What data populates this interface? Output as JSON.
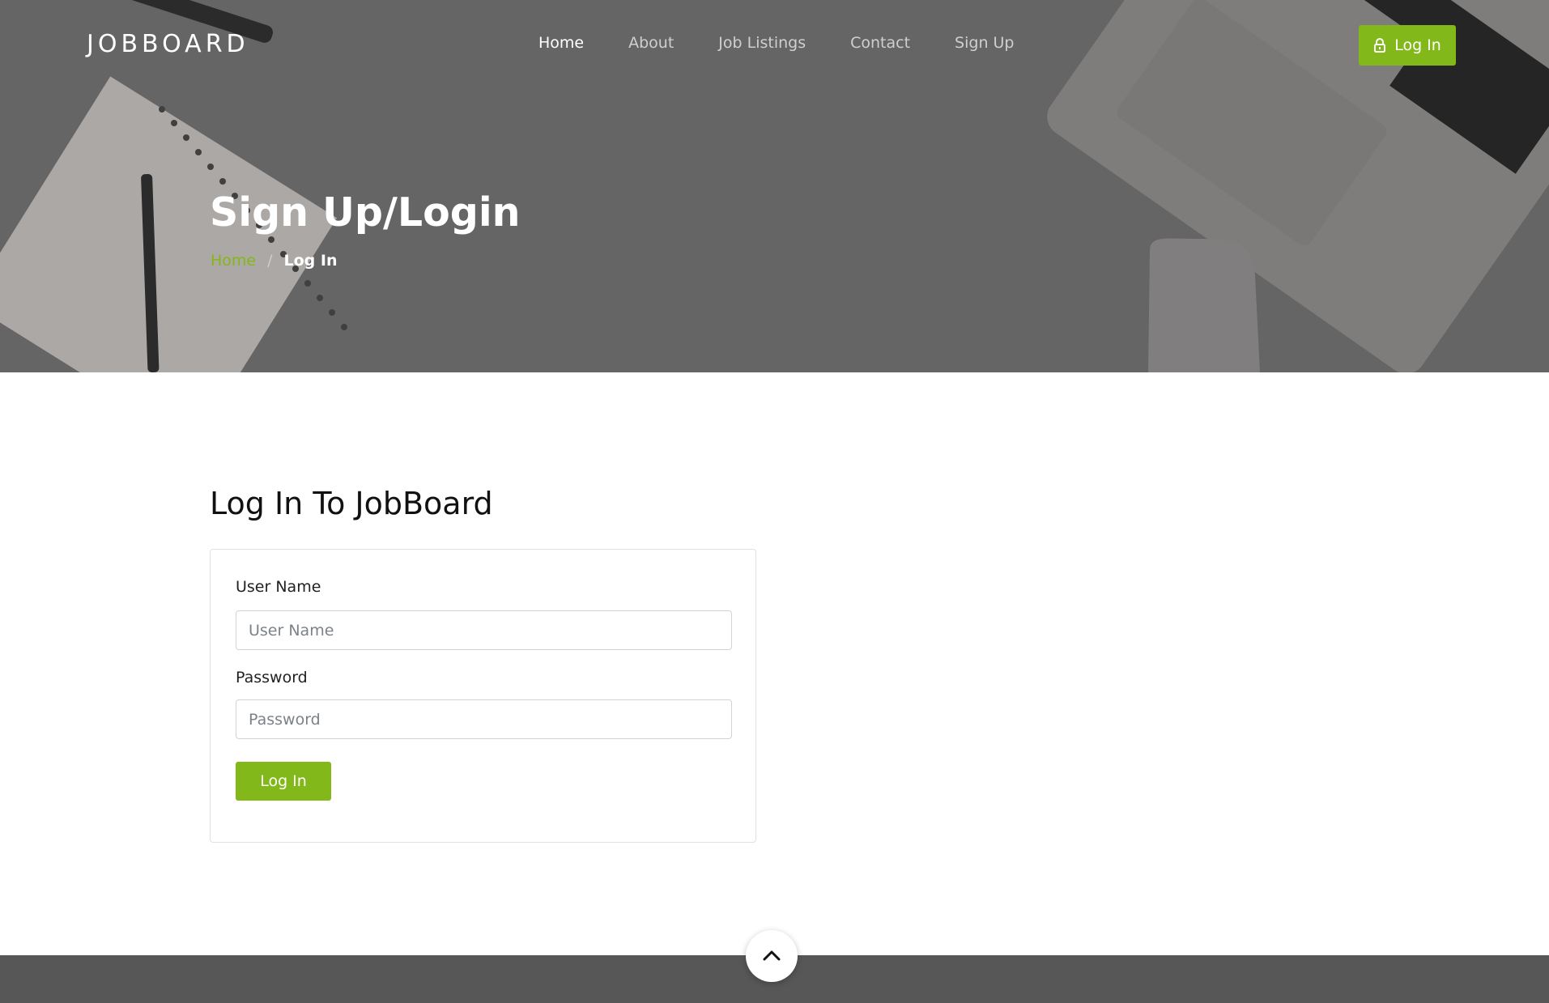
{
  "brand": "JOBBOARD",
  "nav": {
    "items": [
      {
        "label": "Home",
        "active": true
      },
      {
        "label": "About",
        "active": false
      },
      {
        "label": "Job Listings",
        "active": false
      },
      {
        "label": "Contact",
        "active": false
      },
      {
        "label": "Sign Up",
        "active": false
      }
    ],
    "login_button": {
      "label": "Log In",
      "icon": "lock-icon"
    }
  },
  "hero": {
    "title": "Sign Up/Login",
    "breadcrumb": {
      "home": "Home",
      "separator": "/",
      "current": "Log In"
    }
  },
  "main": {
    "section_title": "Log In To JobBoard",
    "form": {
      "username": {
        "label": "User Name",
        "placeholder": "User Name",
        "value": ""
      },
      "password": {
        "label": "Password",
        "placeholder": "Password",
        "value": ""
      },
      "submit_label": "Log In"
    }
  },
  "back_to_top": {
    "icon": "chevron-up-icon"
  },
  "colors": {
    "accent": "#83b81a",
    "hero_bg": "#6c6b6d",
    "footer_bg": "#575757"
  }
}
